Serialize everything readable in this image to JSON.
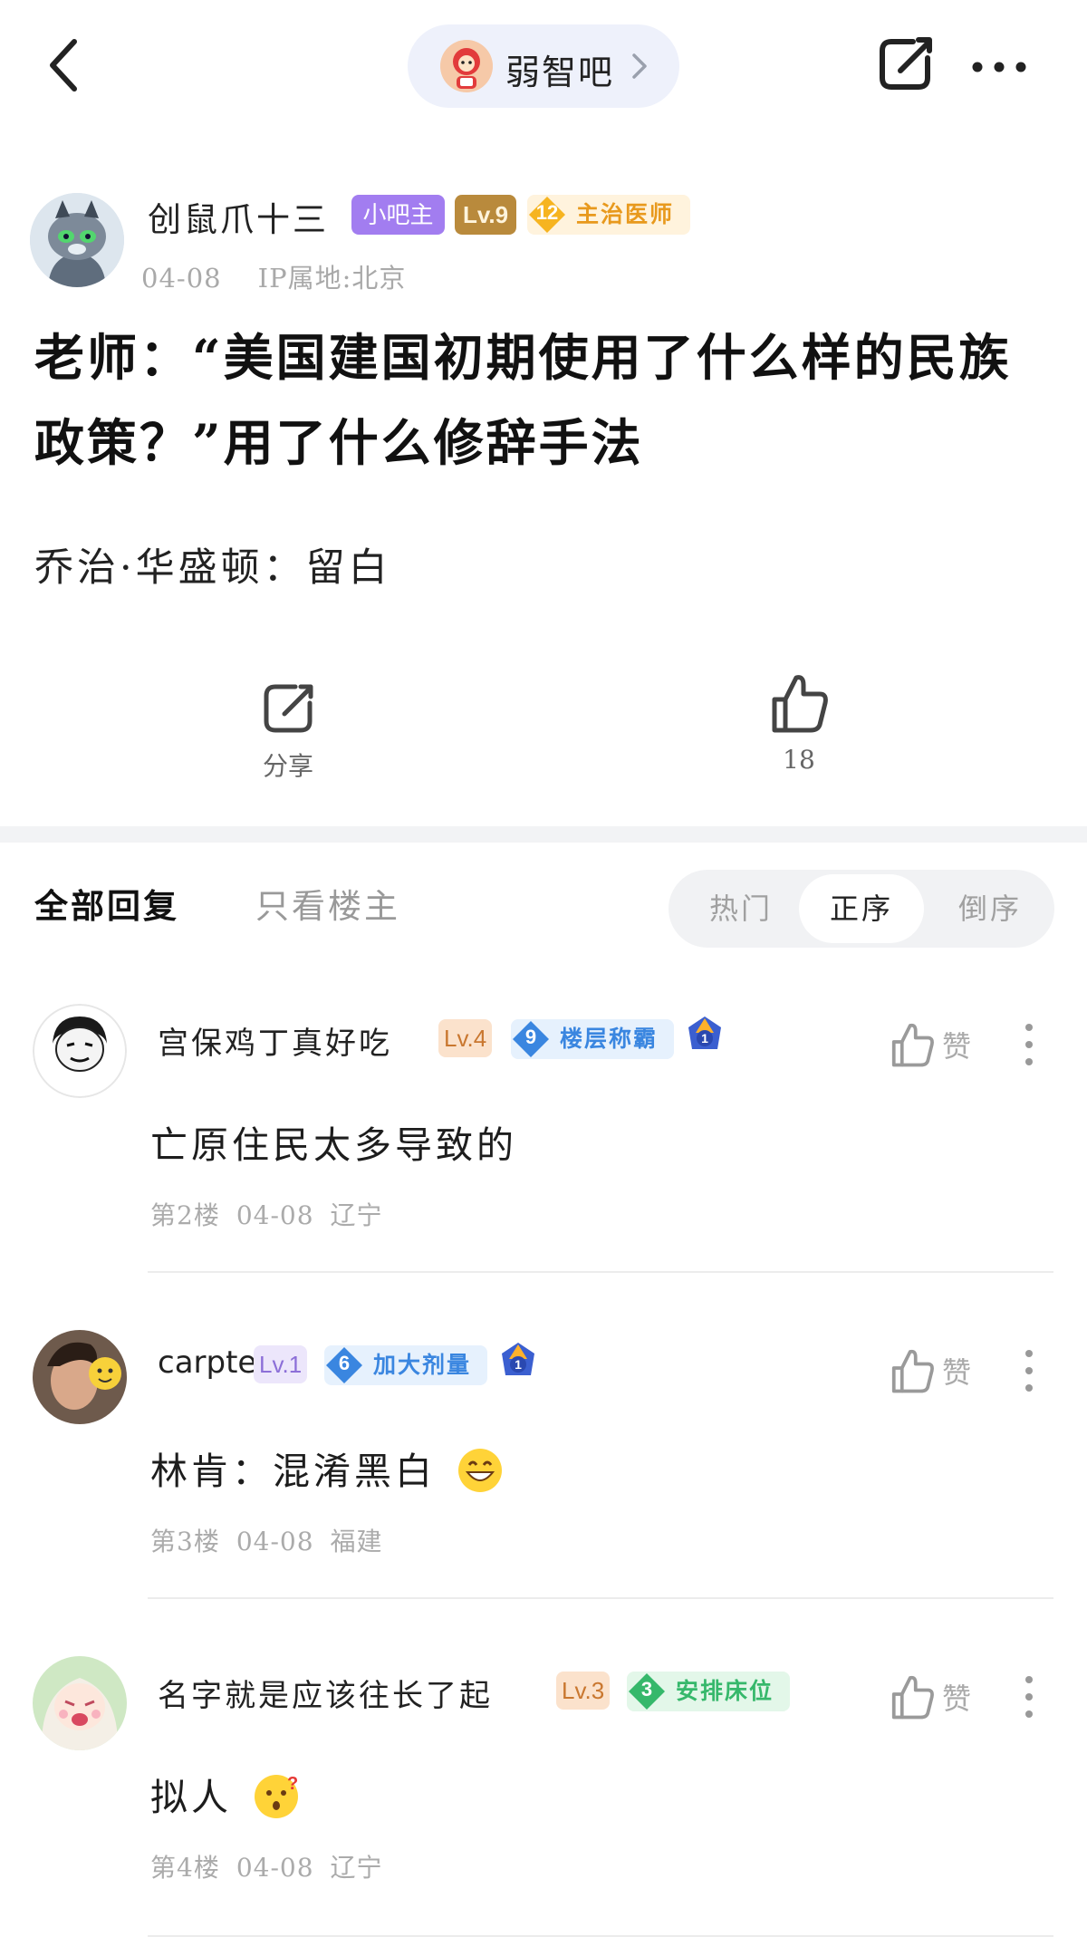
{
  "topbar": {
    "forum_name": "弱智吧",
    "icons": [
      "back-icon",
      "chevron-right-icon",
      "share-icon",
      "more-icon"
    ]
  },
  "post": {
    "author": {
      "name": "创鼠爪十三",
      "role_badge": "小吧主",
      "level": "Lv.9",
      "title_number": "12",
      "title_text": "主治医师"
    },
    "date": "04-08",
    "ip_location": "IP属地:北京",
    "title": "老师：“美国建国初期使用了什么样的民族政策？”用了什么修辞手法",
    "body": "乔治·华盛顿：留白",
    "actions": {
      "share_label": "分享",
      "like_count": "18"
    }
  },
  "tabs": {
    "all_replies": "全部回复",
    "op_only": "只看楼主"
  },
  "sort": {
    "options": [
      "热门",
      "正序",
      "倒序"
    ],
    "selected": "正序"
  },
  "replies": [
    {
      "name": "宫保鸡丁真好吃",
      "level": "Lv.4",
      "title_number": "9",
      "title_text": "楼层称霸",
      "medal": "1",
      "text": "亡原住民太多导致的",
      "floor": "第2楼",
      "date": "04-08",
      "location": "辽宁",
      "like_label": "赞"
    },
    {
      "name": "carpte",
      "level": "Lv.1",
      "title_number": "6",
      "title_text": "加大剂量",
      "medal": "1",
      "text": "林肯：混淆黑白",
      "floor": "第3楼",
      "date": "04-08",
      "location": "福建",
      "like_label": "赞"
    },
    {
      "name": "名字就是应该往长了起",
      "level": "Lv.3",
      "title_number": "3",
      "title_text": "安排床位",
      "text": "拟人",
      "floor": "第4楼",
      "date": "04-08",
      "location": "辽宁",
      "like_label": "赞"
    }
  ],
  "colors": {
    "admin_badge": "#a27df0",
    "lv9_badge": "#b98a3c",
    "author_title": "#e8991d",
    "blue_title": "#3a86e0",
    "green_title": "#36b86b",
    "divider": "#f2f3f5"
  }
}
